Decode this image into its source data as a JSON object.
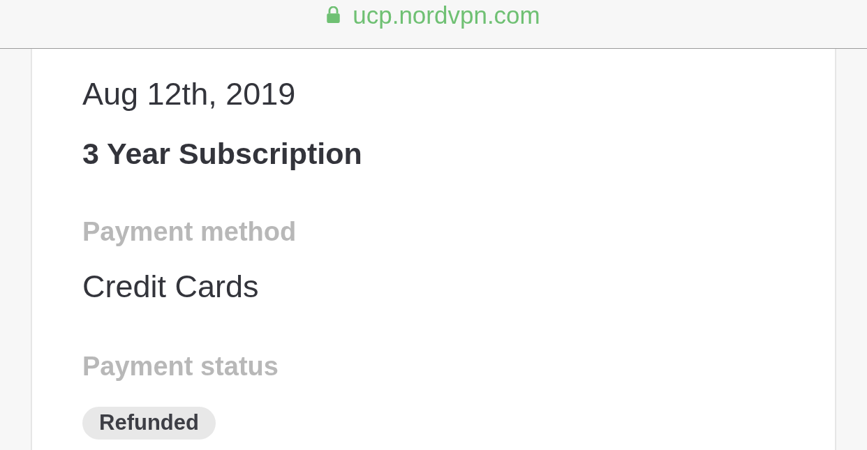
{
  "address_bar": {
    "secure": true,
    "url": "ucp.nordvpn.com"
  },
  "payment": {
    "date": "Aug 12th, 2019",
    "title": "3 Year Subscription",
    "fields": [
      {
        "label": "Payment method",
        "kind": "text",
        "value": "Credit Cards"
      },
      {
        "label": "Payment status",
        "kind": "badge",
        "value": "Refunded"
      }
    ]
  }
}
